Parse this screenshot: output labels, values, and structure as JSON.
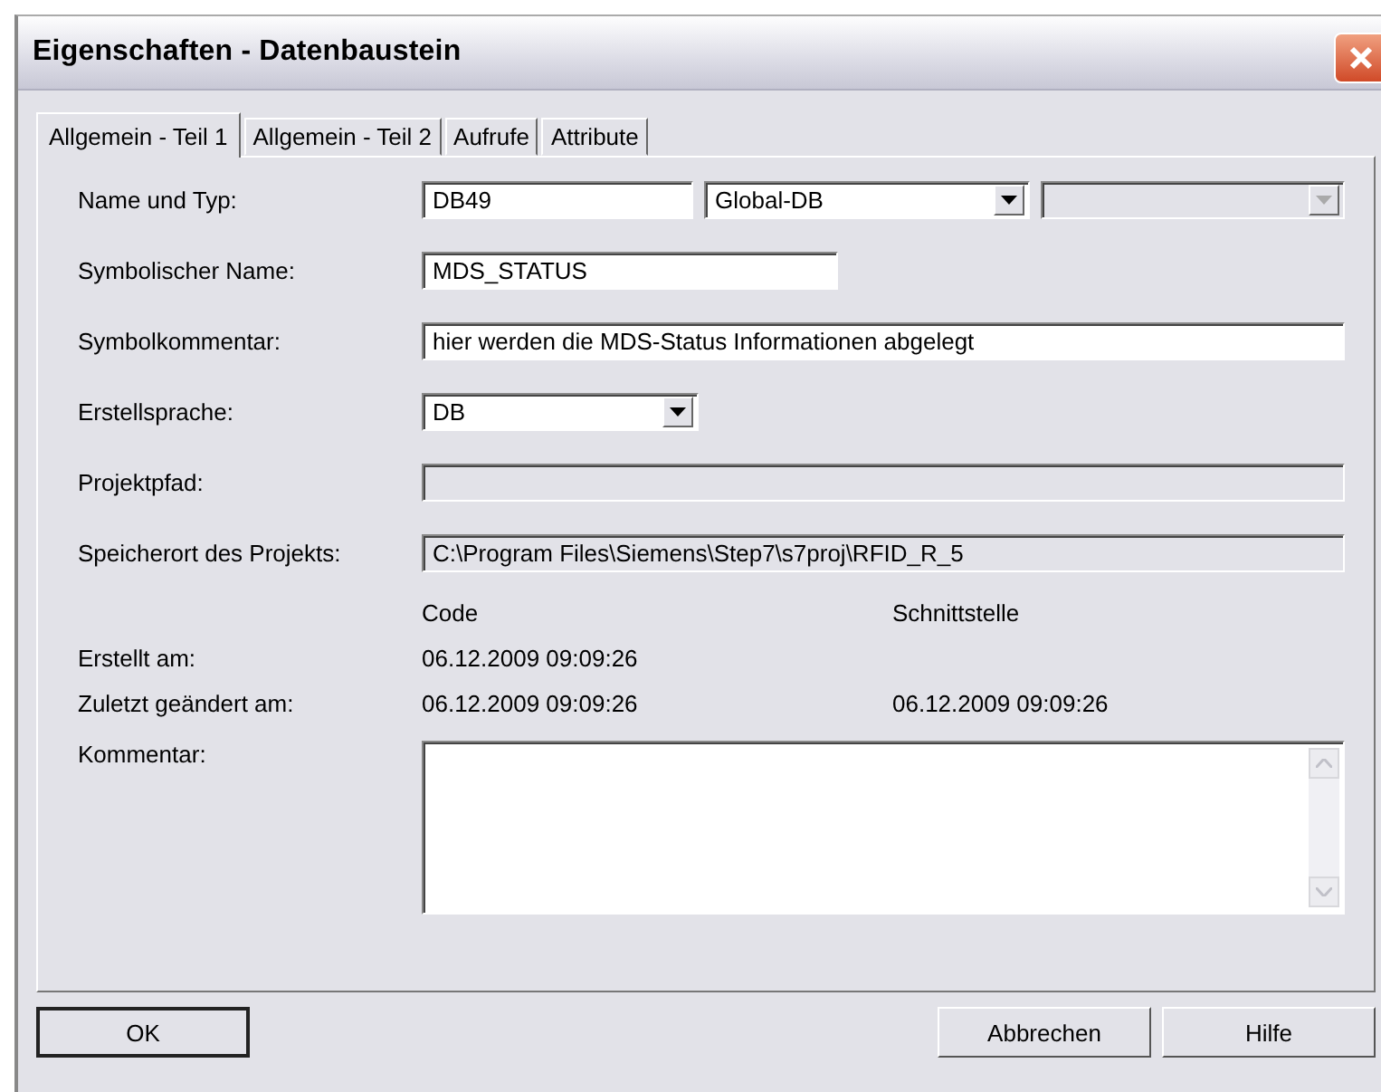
{
  "window": {
    "title": "Eigenschaften - Datenbaustein"
  },
  "tabs": [
    {
      "label": "Allgemein - Teil 1",
      "selected": true
    },
    {
      "label": "Allgemein - Teil 2",
      "selected": false
    },
    {
      "label": "Aufrufe",
      "selected": false
    },
    {
      "label": "Attribute",
      "selected": false
    }
  ],
  "fields": [
    {
      "label": "Name und Typ:",
      "controls": [
        {
          "kind": "text",
          "value": "DB49",
          "disabled": false
        },
        {
          "kind": "combo",
          "value": "Global-DB",
          "disabled": false
        },
        {
          "kind": "combo",
          "disabled": true
        }
      ]
    },
    {
      "label": "Symbolischer Name:",
      "controls": [
        {
          "kind": "text",
          "value": "MDS_STATUS",
          "disabled": false
        }
      ]
    },
    {
      "label": "Symbolkommentar:",
      "controls": [
        {
          "kind": "text",
          "value": "hier werden die MDS-Status Informationen abgelegt",
          "disabled": false
        }
      ]
    },
    {
      "label": "Erstellsprache:",
      "controls": [
        {
          "kind": "combo",
          "value": "DB",
          "disabled": false
        }
      ]
    },
    {
      "label": "Projektpfad:",
      "controls": [
        {
          "kind": "text",
          "disabled": true
        }
      ]
    },
    {
      "label": "Speicherort des Projekts:",
      "controls": [
        {
          "kind": "text",
          "value": "C:\\Program Files\\Siemens\\Step7\\s7proj\\RFID_R_5",
          "disabled": true
        }
      ]
    }
  ],
  "dates": {
    "columns": [
      "Code",
      "Schnittstelle"
    ],
    "rows": [
      {
        "label": "Erstellt am:",
        "code": "06.12.2009 09:09:26"
      },
      {
        "label": "Zuletzt geändert am:",
        "code": "06.12.2009 09:09:26",
        "interface": "06.12.2009 09:09:26"
      }
    ]
  },
  "comment": {
    "label": "Kommentar:"
  },
  "buttons": [
    {
      "label": "OK",
      "default": true
    },
    {
      "label": "Abbrechen",
      "default": false
    },
    {
      "label": "Hilfe",
      "default": false
    }
  ]
}
